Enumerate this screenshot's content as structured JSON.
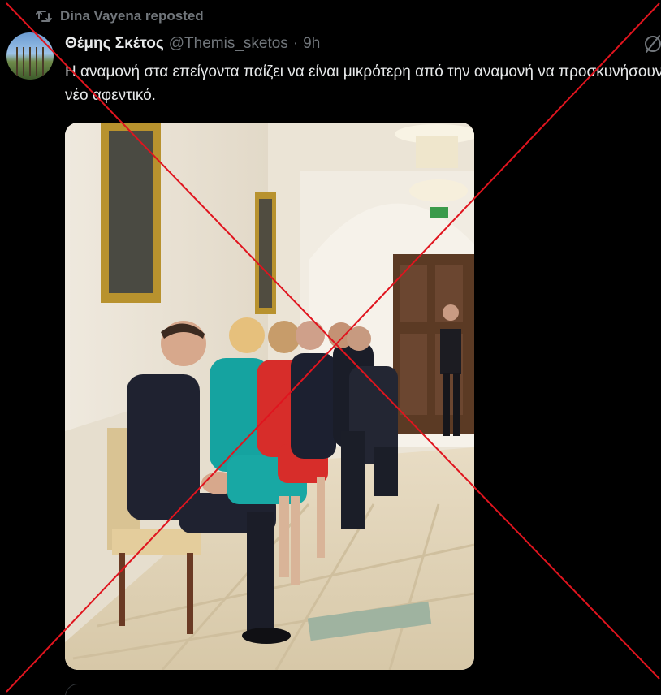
{
  "repost": {
    "label": "Dina Vayena reposted",
    "icon": "repost-icon"
  },
  "tweet": {
    "display_name": "Θέμης Σκέτος",
    "handle": "@Themis_sketos",
    "separator": "·",
    "time": "9h",
    "text": "Η αναμονή στα επείγοντα παίζει να είναι μικρότερη από την αναμονή να προσκυνήσουν το νέο αφεντικό.",
    "avatar_icon": "avatar",
    "grok_icon": "grok-icon"
  },
  "overlay": {
    "cross_color": "#e0141e"
  },
  "colors": {
    "background": "#000000",
    "text_primary": "#e7e9ea",
    "text_secondary": "#71767b",
    "border": "#2f3336"
  }
}
